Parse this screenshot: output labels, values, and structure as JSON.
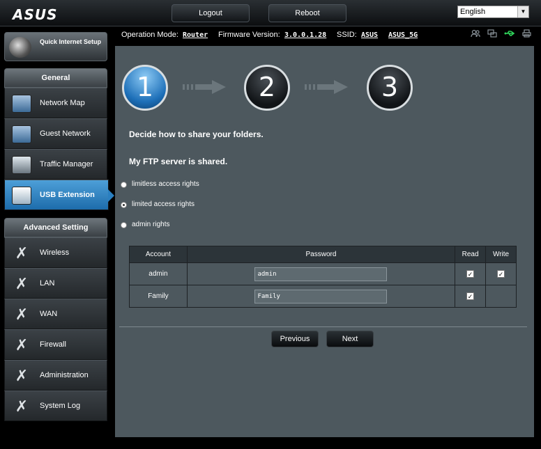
{
  "brand": {
    "logo": "ASUS"
  },
  "topbar": {
    "logout_label": "Logout",
    "reboot_label": "Reboot",
    "language": "English"
  },
  "status": {
    "operation_mode_label": "Operation Mode:",
    "operation_mode_value": "Router",
    "firmware_label": "Firmware Version:",
    "firmware_value": "3.0.0.1.28",
    "ssid_label": "SSID:",
    "ssid_1": "ASUS",
    "ssid_2": "ASUS_5G",
    "icons": [
      "users-icon",
      "copy-icon",
      "usb-icon",
      "printer-icon"
    ]
  },
  "sidebar": {
    "quick_setup_label": "Quick Internet Setup",
    "general_label": "General",
    "general_items": [
      {
        "label": "Network Map",
        "icon": "network-map-icon"
      },
      {
        "label": "Guest Network",
        "icon": "guest-network-icon"
      },
      {
        "label": "Traffic Manager",
        "icon": "traffic-manager-icon"
      },
      {
        "label": "USB Extension",
        "icon": "usb-extension-icon",
        "active": true
      }
    ],
    "advanced_label": "Advanced Setting",
    "advanced_items": [
      {
        "label": "Wireless"
      },
      {
        "label": "LAN"
      },
      {
        "label": "WAN"
      },
      {
        "label": "Firewall"
      },
      {
        "label": "Administration"
      },
      {
        "label": "System Log"
      }
    ]
  },
  "wizard": {
    "steps": [
      "1",
      "2",
      "3"
    ],
    "current_step": 1,
    "heading": "Decide how to share your folders.",
    "subheading": "My FTP server is shared.",
    "options": [
      {
        "label": "limitless access rights",
        "checked": false
      },
      {
        "label": "limited access rights",
        "checked": true
      },
      {
        "label": "admin rights",
        "checked": false
      }
    ],
    "table": {
      "headers": [
        "Account",
        "Password",
        "Read",
        "Write"
      ],
      "rows": [
        {
          "account": "admin",
          "password": "admin",
          "read": true,
          "write": true
        },
        {
          "account": "Family",
          "password": "Family",
          "read": true,
          "write": false
        }
      ]
    },
    "previous_label": "Previous",
    "next_label": "Next"
  },
  "colors": {
    "accent": "#2a7fc0",
    "panel": "#4d585e",
    "background": "#000000"
  }
}
